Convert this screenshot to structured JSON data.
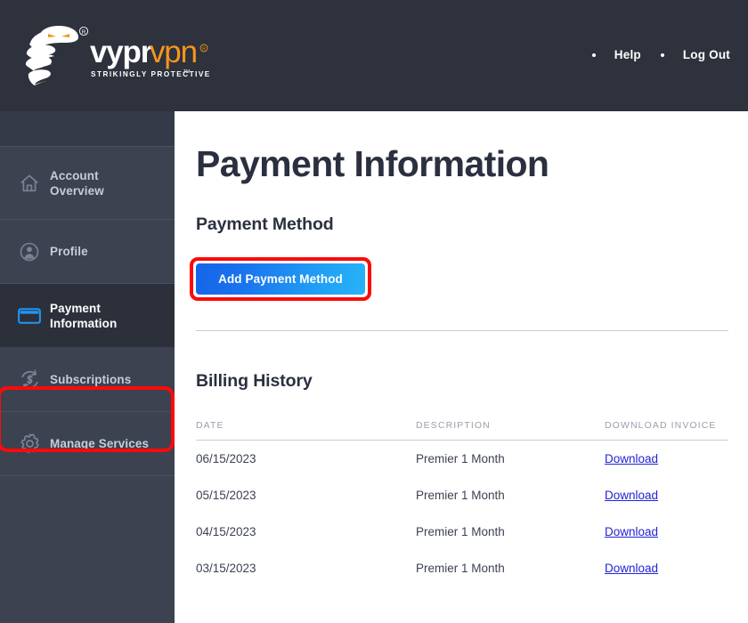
{
  "header": {
    "logo": {
      "icon_name": "vypr-cobra-logo-icon",
      "wordmark_primary": "vypr",
      "wordmark_accent": "vpn",
      "registered_mark": "®",
      "tagline": "STRIKINGLY PROTECTIVE",
      "tagline_mark": "™",
      "accent_color": "#f7941e",
      "text_color": "#ffffff"
    },
    "background_color": "#2d323c",
    "nav": [
      {
        "label": "Help",
        "bullet": "•"
      },
      {
        "label": "Log Out",
        "bullet": "•"
      }
    ]
  },
  "sidebar": {
    "background_color": "#3c4250",
    "active_background_color": "#2b303b",
    "active_icon_color": "#2196f3",
    "items": [
      {
        "label": "Account\nOverview",
        "icon": "home-icon",
        "active": false
      },
      {
        "label": "Profile",
        "icon": "user-circle-icon",
        "active": false
      },
      {
        "label": "Payment\nInformation",
        "icon": "credit-card-icon",
        "active": true
      },
      {
        "label": "Subscriptions",
        "icon": "refresh-dollar-icon",
        "active": false
      },
      {
        "label": "Manage Services",
        "icon": "gear-icon",
        "active": false
      }
    ]
  },
  "main": {
    "page_title": "Payment Information",
    "payment_method": {
      "heading": "Payment Method",
      "add_button_label": "Add Payment Method",
      "add_button_color": "#1a73ef"
    },
    "billing_history": {
      "heading": "Billing History",
      "columns": [
        "DATE",
        "DESCRIPTION",
        "DOWNLOAD INVOICE"
      ],
      "rows": [
        {
          "date": "06/15/2023",
          "description": "Premier 1 Month",
          "download_label": "Download"
        },
        {
          "date": "05/15/2023",
          "description": "Premier 1 Month",
          "download_label": "Download"
        },
        {
          "date": "04/15/2023",
          "description": "Premier 1 Month",
          "download_label": "Download"
        },
        {
          "date": "03/15/2023",
          "description": "Premier 1 Month",
          "download_label": "Download"
        }
      ]
    }
  },
  "annotations": {
    "highlight_color": "#fc0a0a",
    "targets": [
      "sidebar-item-payment-information",
      "add-payment-method-button"
    ]
  }
}
